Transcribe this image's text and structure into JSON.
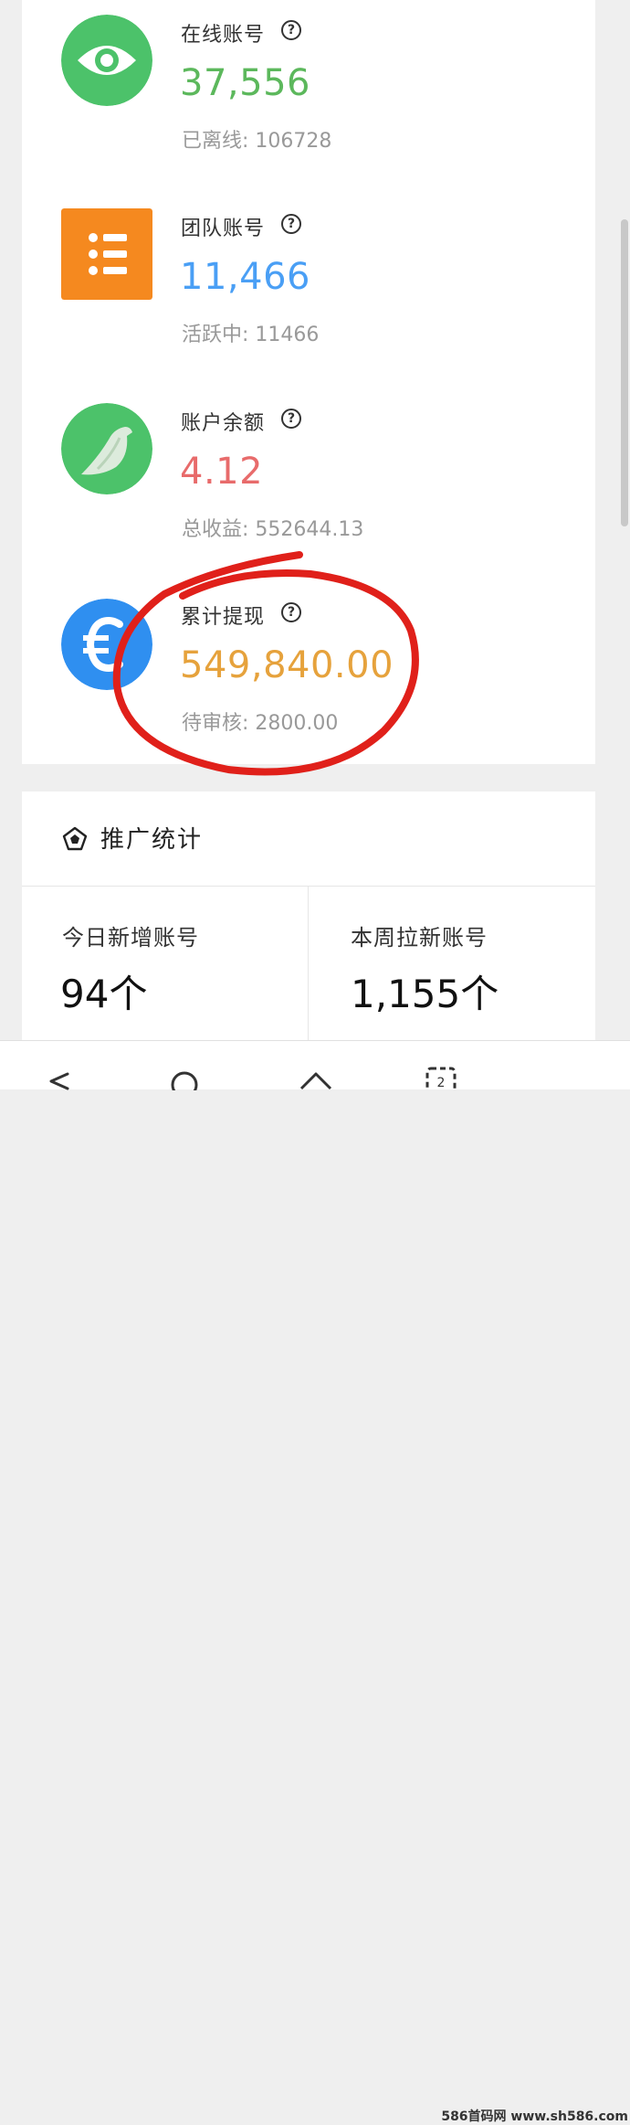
{
  "stats": {
    "online": {
      "label": "在线账号",
      "value": "37,556",
      "sub": "已离线: 106728",
      "color": "#5cb85c"
    },
    "team": {
      "label": "团队账号",
      "value": "11,466",
      "sub": "活跃中: 11466",
      "color": "#4a9ff5"
    },
    "balance": {
      "label": "账户余额",
      "value": "4.12",
      "sub": "总收益: 552644.13",
      "color": "#e86b6b"
    },
    "withdraw": {
      "label": "累计提现",
      "value": "549,840.00",
      "sub": "待审核: 2800.00",
      "color": "#e6a23c"
    }
  },
  "help_glyph": "?",
  "promo": {
    "title": "推广统计",
    "today_label": "今日新增账号",
    "today_value": "94个",
    "week_label": "本周拉新账号",
    "week_value": "1,155个"
  },
  "watermark": "586首码网 www.sh586.com",
  "colors": {
    "green_icon": "#4cc26a",
    "orange_icon": "#f5891f",
    "blue_icon": "#2f8ff0",
    "annotation": "#e0201a"
  },
  "icons": {
    "online": "eye-icon",
    "team": "list-icon",
    "balance": "bird-icon",
    "withdraw": "euro-icon",
    "promo": "pentagon-icon"
  }
}
